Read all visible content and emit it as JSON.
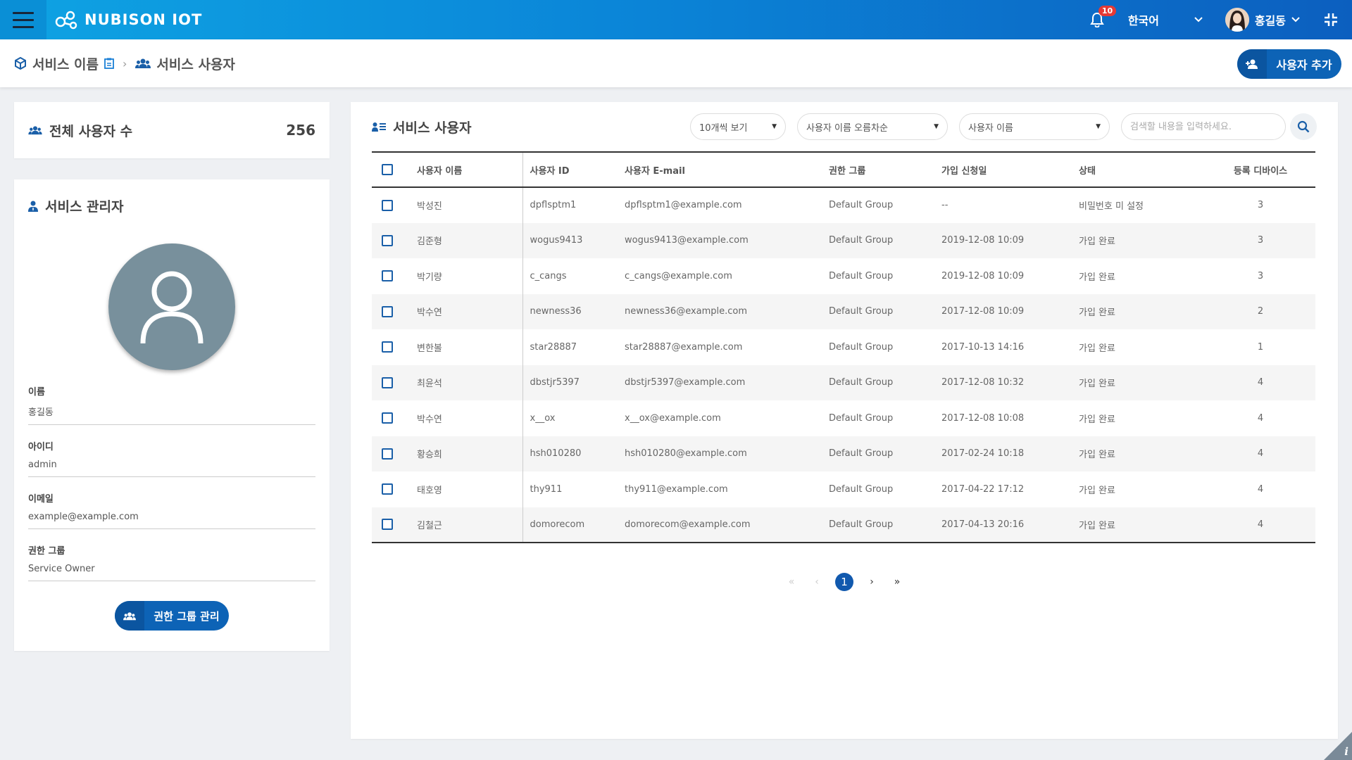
{
  "topbar": {
    "logo_text": "NUBISON IOT",
    "notification_count": "10",
    "language": "한국어",
    "user_name": "홍길동"
  },
  "breadcrumb": {
    "service": "서비스 이름",
    "page": "서비스 사용자"
  },
  "header": {
    "add_user_label": "사용자 추가"
  },
  "total_users": {
    "title": "전체 사용자 수",
    "count": "256"
  },
  "admin": {
    "title": "서비스 관리자",
    "fields": [
      {
        "label": "이름",
        "value": "홍길동"
      },
      {
        "label": "아이디",
        "value": "admin"
      },
      {
        "label": "이메일",
        "value": "example@example.com"
      },
      {
        "label": "권한 그룹",
        "value": "Service Owner"
      }
    ],
    "role_button_label": "권한 그룹 관리"
  },
  "users": {
    "title": "서비스 사용자",
    "page_size": "10개씩 보기",
    "sort": "사용자 이름 오름차순",
    "search_field": "사용자 이름",
    "search_placeholder": "검색할 내용을 입력하세요.",
    "columns": [
      "사용자 이름",
      "사용자 ID",
      "사용자 E-mail",
      "권한 그룹",
      "가입 신청일",
      "상태",
      "등록 디바이스"
    ],
    "rows": [
      [
        "박성진",
        "dpflsptm1",
        "dpflsptm1@example.com",
        "Default Group",
        "--",
        "비밀번호 미 설정",
        "3"
      ],
      [
        "김준형",
        "wogus9413",
        "wogus9413@example.com",
        "Default Group",
        "2019-12-08 10:09",
        "가입 완료",
        "3"
      ],
      [
        "박기량",
        "c_cangs",
        "c_cangs@example.com",
        "Default Group",
        "2019-12-08 10:09",
        "가입 완료",
        "3"
      ],
      [
        "박수연",
        "newness36",
        "newness36@example.com",
        "Default Group",
        "2017-12-08 10:09",
        "가입 완료",
        "2"
      ],
      [
        "변한볼",
        "star28887",
        "star28887@example.com",
        "Default Group",
        "2017-10-13 14:16",
        "가입 완료",
        "1"
      ],
      [
        "최윤석",
        "dbstjr5397",
        "dbstjr5397@example.com",
        "Default Group",
        "2017-12-08 10:32",
        "가입 완료",
        "4"
      ],
      [
        "박수연",
        "x__ox",
        "x__ox@example.com",
        "Default Group",
        "2017-12-08 10:08",
        "가입 완료",
        "4"
      ],
      [
        "황승희",
        "hsh010280",
        "hsh010280@example.com",
        "Default Group",
        "2017-02-24 10:18",
        "가입 완료",
        "4"
      ],
      [
        "태호영",
        "thy911",
        "thy911@example.com",
        "Default Group",
        "2017-04-22 17:12",
        "가입 완료",
        "4"
      ],
      [
        "김철근",
        "domorecom",
        "domorecom@example.com",
        "Default Group",
        "2017-04-13 20:16",
        "가입 완료",
        "4"
      ]
    ]
  },
  "pagination": {
    "first": "«",
    "prev": "‹",
    "current": "1",
    "next": "›",
    "last": "»"
  },
  "info_label": "i"
}
